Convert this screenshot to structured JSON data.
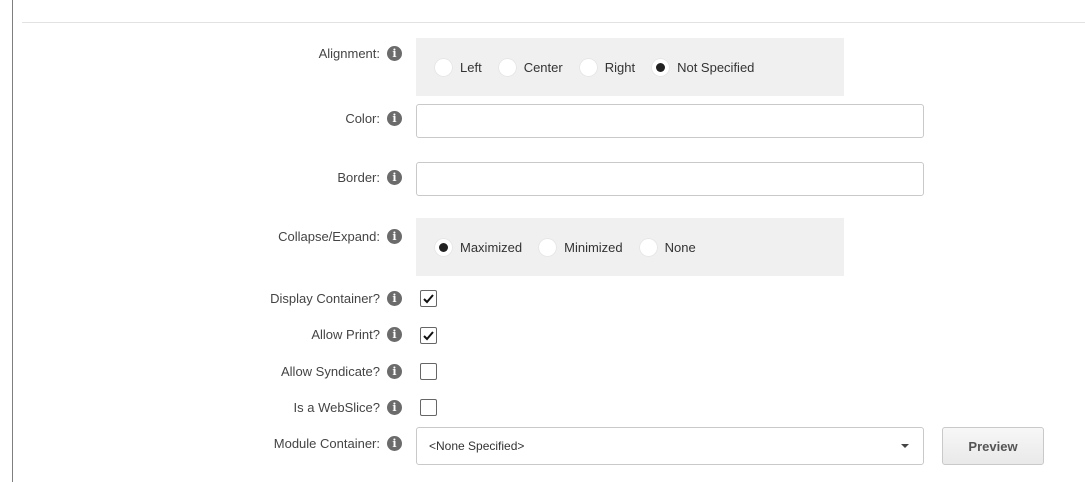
{
  "fields": {
    "alignment": {
      "label": "Alignment:",
      "options": [
        {
          "label": "Left",
          "checked": false
        },
        {
          "label": "Center",
          "checked": false
        },
        {
          "label": "Right",
          "checked": false
        },
        {
          "label": "Not Specified",
          "checked": true
        }
      ]
    },
    "color": {
      "label": "Color:",
      "value": ""
    },
    "border": {
      "label": "Border:",
      "value": ""
    },
    "collapse_expand": {
      "label": "Collapse/Expand:",
      "options": [
        {
          "label": "Maximized",
          "checked": true
        },
        {
          "label": "Minimized",
          "checked": false
        },
        {
          "label": "None",
          "checked": false
        }
      ]
    },
    "display_container": {
      "label": "Display Container?",
      "checked": true
    },
    "allow_print": {
      "label": "Allow Print?",
      "checked": true
    },
    "allow_syndicate": {
      "label": "Allow Syndicate?",
      "checked": false
    },
    "is_webslice": {
      "label": "Is a WebSlice?",
      "checked": false
    },
    "module_container": {
      "label": "Module Container:",
      "selected": "<None Specified>"
    }
  },
  "buttons": {
    "preview": "Preview"
  },
  "icons": {
    "info": "info-icon",
    "info_glyph": "i"
  }
}
